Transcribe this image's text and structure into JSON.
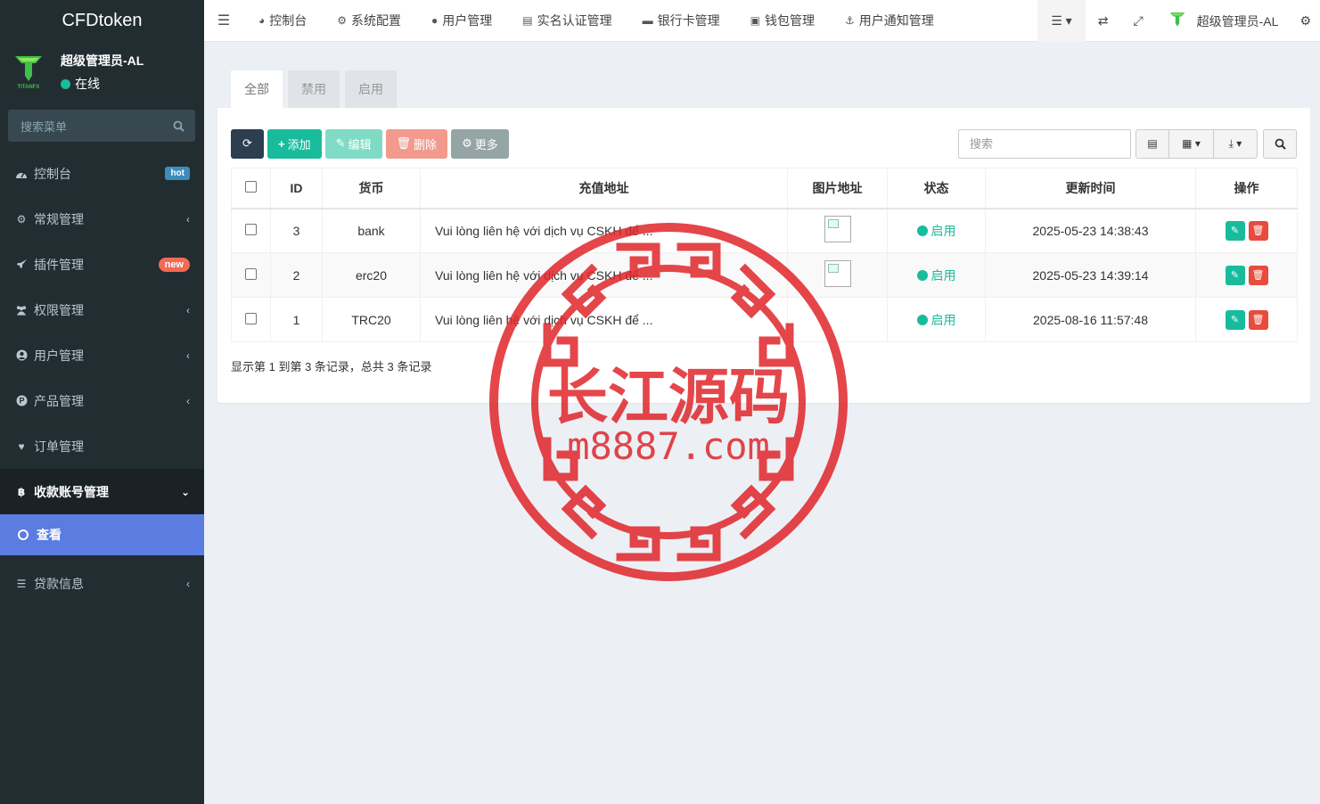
{
  "app": {
    "brand": "CFDtoken"
  },
  "user": {
    "name": "超级管理员-AL",
    "status": "在线",
    "logo_text": "TITANFX"
  },
  "sidebar": {
    "search_placeholder": "搜索菜单",
    "items": [
      {
        "label": "控制台",
        "badge": "hot",
        "icon": "dashboard-icon"
      },
      {
        "label": "常规管理",
        "icon": "cogs-icon",
        "chevron": "‹"
      },
      {
        "label": "插件管理",
        "badge": "new",
        "icon": "rocket-icon"
      },
      {
        "label": "权限管理",
        "icon": "group-icon",
        "chevron": "‹"
      },
      {
        "label": "用户管理",
        "icon": "user-circle-icon",
        "chevron": "‹"
      },
      {
        "label": "产品管理",
        "icon": "product-icon",
        "chevron": "‹"
      },
      {
        "label": "订单管理",
        "icon": "heartbeat-icon"
      },
      {
        "label": "收款账号管理",
        "icon": "bitcoin-icon",
        "chevron": "⌄"
      },
      {
        "label": "查看",
        "icon": "circle-icon"
      },
      {
        "label": "贷款信息",
        "icon": "list-icon",
        "chevron": "‹"
      }
    ]
  },
  "topnav": {
    "items": [
      {
        "label": "控制台",
        "icon": "dashboard-icon"
      },
      {
        "label": "系统配置",
        "icon": "gear-icon"
      },
      {
        "label": "用户管理",
        "icon": "user-icon"
      },
      {
        "label": "实名认证管理",
        "icon": "id-card-icon"
      },
      {
        "label": "银行卡管理",
        "icon": "credit-card-icon"
      },
      {
        "label": "钱包管理",
        "icon": "wallet-icon"
      },
      {
        "label": "用户通知管理",
        "icon": "anchor-icon"
      }
    ],
    "right_user": "超级管理员-AL"
  },
  "tabs": [
    "全部",
    "禁用",
    "启用"
  ],
  "toolbar": {
    "add": "添加",
    "edit": "编辑",
    "delete": "删除",
    "more": "更多",
    "search_placeholder": "搜索"
  },
  "table": {
    "headers": [
      "ID",
      "货币",
      "充值地址",
      "图片地址",
      "状态",
      "更新时间",
      "操作"
    ],
    "rows": [
      {
        "id": "3",
        "currency": "bank",
        "address": "Vui lòng liên hệ với dịch vụ CSKH để ...",
        "has_image": true,
        "status": "启用",
        "updated": "2025-05-23 14:38:43"
      },
      {
        "id": "2",
        "currency": "erc20",
        "address": "Vui lòng liên hệ với dịch vụ CSKH để ...",
        "has_image": true,
        "status": "启用",
        "updated": "2025-05-23 14:39:14"
      },
      {
        "id": "1",
        "currency": "TRC20",
        "address": "Vui lòng liên hệ với dịch vụ CSKH để ...",
        "has_image": false,
        "status": "启用",
        "updated": "2025-08-16 11:57:48"
      }
    ],
    "summary": "显示第 1 到第 3 条记录，总共 3 条记录"
  },
  "watermark": {
    "title": "长江源码",
    "url": "m8887.com",
    "color": "#e0262b"
  }
}
